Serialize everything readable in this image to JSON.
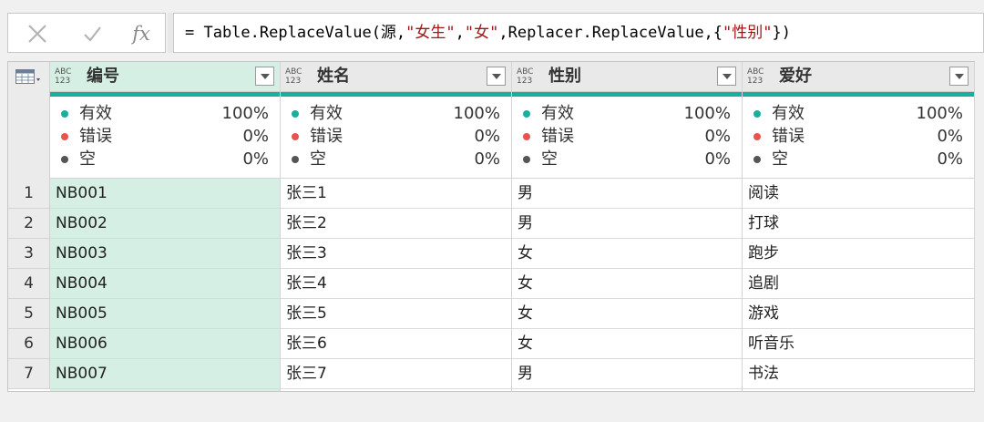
{
  "formula_bar": {
    "cancel_icon": "close-icon",
    "confirm_icon": "check-icon",
    "fx_label": "fx",
    "parts": [
      "= Table.ReplaceValue(源,",
      "\"女生\"",
      ",",
      "\"女\"",
      ",Replacer.ReplaceValue,{",
      "\"性别\"",
      "})"
    ]
  },
  "table": {
    "corner_icon": "table-icon",
    "type_icon": {
      "top": "ABC",
      "bottom": "123"
    },
    "columns": [
      {
        "name": "编号",
        "selected": true
      },
      {
        "name": "姓名",
        "selected": false
      },
      {
        "name": "性别",
        "selected": false
      },
      {
        "name": "爱好",
        "selected": false
      }
    ],
    "quality": [
      {
        "valid_label": "有效",
        "valid_pct": "100%",
        "error_label": "错误",
        "error_pct": "0%",
        "empty_label": "空",
        "empty_pct": "0%"
      },
      {
        "valid_label": "有效",
        "valid_pct": "100%",
        "error_label": "错误",
        "error_pct": "0%",
        "empty_label": "空",
        "empty_pct": "0%"
      },
      {
        "valid_label": "有效",
        "valid_pct": "100%",
        "error_label": "错误",
        "error_pct": "0%",
        "empty_label": "空",
        "empty_pct": "0%"
      },
      {
        "valid_label": "有效",
        "valid_pct": "100%",
        "error_label": "错误",
        "error_pct": "0%",
        "empty_label": "空",
        "empty_pct": "0%"
      }
    ],
    "quality_colors": {
      "valid": "#1aae9f",
      "error": "#e8524f",
      "empty": "#555555"
    },
    "row_numbers": [
      "1",
      "2",
      "3",
      "4",
      "5",
      "6",
      "7"
    ],
    "rows": [
      [
        "NB001",
        "张三1",
        "男",
        "阅读"
      ],
      [
        "NB002",
        "张三2",
        "男",
        "打球"
      ],
      [
        "NB003",
        "张三3",
        "女",
        "跑步"
      ],
      [
        "NB004",
        "张三4",
        "女",
        "追剧"
      ],
      [
        "NB005",
        "张三5",
        "女",
        "游戏"
      ],
      [
        "NB006",
        "张三6",
        "女",
        "听音乐"
      ],
      [
        "NB007",
        "张三7",
        "男",
        "书法"
      ]
    ]
  }
}
